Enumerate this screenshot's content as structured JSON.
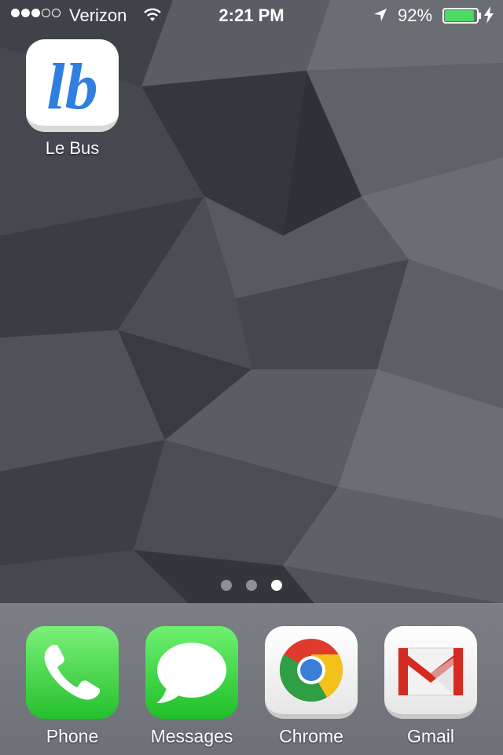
{
  "status_bar": {
    "carrier": "Verizon",
    "signal_bars_filled": 3,
    "signal_bars_total": 5,
    "time": "2:21 PM",
    "battery_percent": "92%",
    "battery_level": 0.92
  },
  "home_apps": [
    {
      "label": "Le Bus",
      "icon": "le-bus-logo-icon",
      "logo_text": "lb"
    }
  ],
  "page_indicator": {
    "count": 3,
    "active_index": 2
  },
  "dock": [
    {
      "label": "Phone",
      "icon": "phone-icon"
    },
    {
      "label": "Messages",
      "icon": "messages-icon"
    },
    {
      "label": "Chrome",
      "icon": "chrome-icon"
    },
    {
      "label": "Gmail",
      "icon": "gmail-icon"
    }
  ],
  "colors": {
    "lebus_blue": "#2f7fe0",
    "phone_green": "#4cd964",
    "battery_green": "#4cd964",
    "gmail_red": "#d42a20"
  }
}
